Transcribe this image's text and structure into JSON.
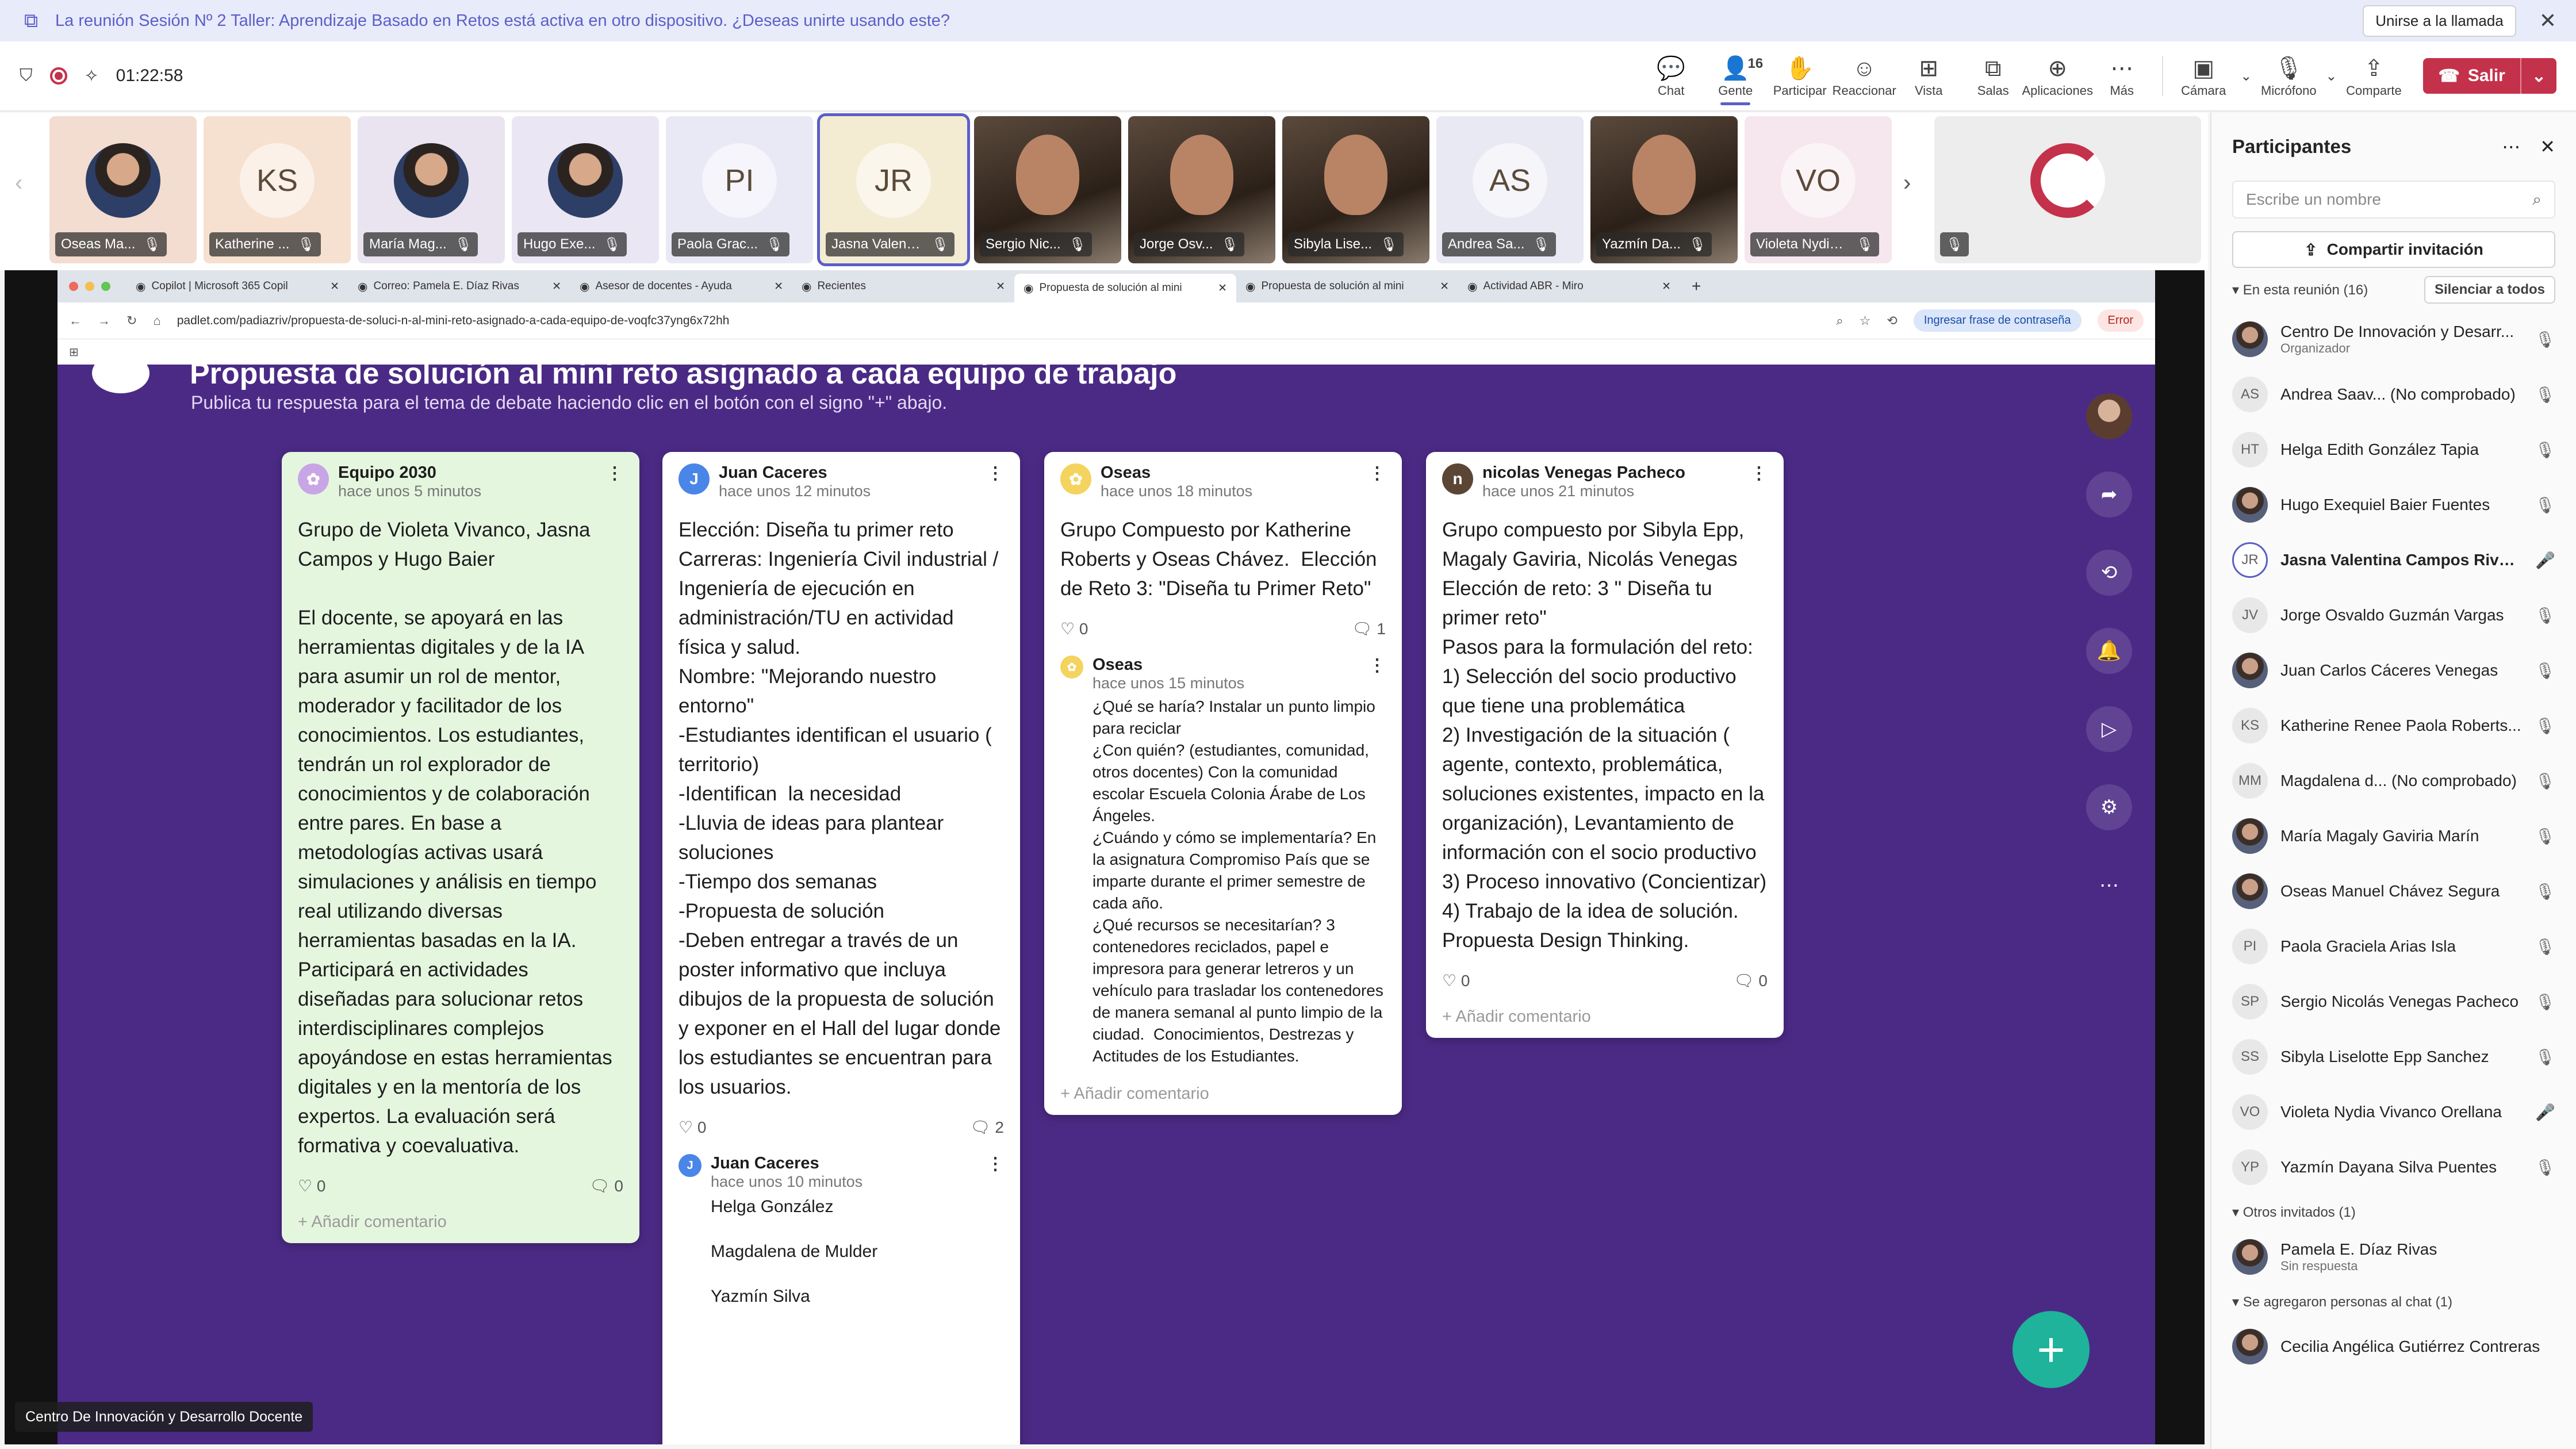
{
  "banner": {
    "text": "La reunión Sesión Nº 2 Taller: Aprendizaje Basado en Retos está activa en otro dispositivo. ¿Deseas unirte usando este?",
    "join_label": "Unirse a la llamada"
  },
  "toolbar": {
    "timer": "01:22:58",
    "people_count": "16",
    "buttons": {
      "chat": "Chat",
      "people": "Gente",
      "raise": "Participar",
      "react": "Reaccionar",
      "view": "Vista",
      "rooms": "Salas",
      "apps": "Aplicaciones",
      "more": "Más",
      "camera": "Cámara",
      "mic": "Micrófono",
      "share": "Comparte"
    },
    "leave_label": "Salir"
  },
  "strip": {
    "tiles": [
      {
        "name": "Oseas Ma...",
        "initials": ""
      },
      {
        "name": "Katherine ...",
        "initials": "KS"
      },
      {
        "name": "María Mag...",
        "initials": ""
      },
      {
        "name": "Hugo Exe...",
        "initials": ""
      },
      {
        "name": "Paola Grac...",
        "initials": "PI"
      },
      {
        "name": "Jasna Valentin...",
        "initials": "JR"
      },
      {
        "name": "Sergio Nic...",
        "initials": ""
      },
      {
        "name": "Jorge Osv...",
        "initials": ""
      },
      {
        "name": "Sibyla Lise...",
        "initials": ""
      },
      {
        "name": "Andrea Sa...",
        "initials": "AS"
      },
      {
        "name": "Yazmín Da...",
        "initials": ""
      },
      {
        "name": "Violeta Nydia ...",
        "initials": "VO"
      }
    ]
  },
  "browser": {
    "tabs": [
      "Copilot | Microsoft 365 Copil",
      "Correo: Pamela E. Díaz Rivas",
      "Asesor de docentes - Ayuda",
      "Recientes",
      "Propuesta de solución al mini",
      "Propuesta de solución al mini",
      "Actividad ABR - Miro"
    ],
    "url": "padlet.com/padiazriv/propuesta-de-soluci-n-al-mini-reto-asignado-a-cada-equipo-de-voqfc37yng6x72hh",
    "passphrase": "Ingresar frase de contraseña",
    "error": "Error"
  },
  "padlet": {
    "title": "Propuesta de solución al mini reto asignado a cada equipo de trabajo",
    "subtitle": "Publica tu respuesta para el tema de debate haciendo clic en el botón con el signo \"+\" abajo.",
    "add_comment": "Añadir comentario",
    "cards": [
      {
        "author": "Equipo 2030",
        "time": "hace unos 5 minutos",
        "body": "Grupo de Violeta Vivanco, Jasna Campos y Hugo Baier\n\nEl docente, se apoyará en las herramientas digitales y de la IA para asumir un rol de mentor, moderador y facilitador de los conocimientos. Los estudiantes, tendrán un rol explorador de conocimientos y de colaboración entre pares. En base a metodologías activas usará simulaciones y análisis en tiempo real utilizando diversas herramientas basadas en la IA. Participará en actividades diseñadas para solucionar retos interdisciplinares complejos apoyándose en estas herramientas digitales y en la mentoría de los expertos. La evaluación será formativa y coevaluativa.",
        "likes": "0",
        "comments": "0"
      },
      {
        "author": "Juan Caceres",
        "time": "hace unos 12 minutos",
        "body": "Elección: Diseña tu primer reto\nCarreras: Ingeniería Civil industrial / Ingeniería de ejecución en administración/TU en actividad física y salud.\nNombre: \"Mejorando nuestro entorno\"\n-Estudiantes identifican el usuario ( territorio)\n-Identifican  la necesidad\n-Lluvia de ideas para plantear soluciones\n-Tiempo dos semanas\n-Propuesta de solución\n-Deben entregar a través de un poster informativo que incluya dibujos de la propuesta de solución y exponer en el Hall del lugar donde los estudiantes se encuentran para  los usuarios.",
        "likes": "0",
        "comments": "2",
        "reply": {
          "author": "Juan Caceres",
          "time": "hace unos 10 minutos",
          "body": "Helga González\n\nMagdalena de Mulder\n\nYazmín Silva"
        }
      },
      {
        "author": "Oseas",
        "time": "hace unos 18 minutos",
        "body": "Grupo Compuesto por Katherine Roberts y Oseas Chávez.  Elección de Reto 3: \"Diseña tu Primer Reto\"",
        "likes": "0",
        "comments": "1",
        "reply": {
          "author": "Oseas",
          "time": "hace unos 15 minutos",
          "body": "¿Qué se haría? Instalar un punto limpio para reciclar\n¿Con quién? (estudiantes, comunidad, otros docentes) Con la comunidad escolar Escuela Colonia Árabe de Los Ángeles.\n¿Cuándo y cómo se implementaría? En la asignatura Compromiso País que se imparte durante el primer semestre de cada año.\n¿Qué recursos se necesitarían? 3 contenedores reciclados, papel e impresora para generar letreros y un vehículo para trasladar los contenedores de manera semanal al punto limpio de la ciudad.  Conocimientos, Destrezas y Actitudes de los Estudiantes."
        }
      },
      {
        "author": "nicolas Venegas Pacheco",
        "time": "hace unos 21 minutos",
        "body": "Grupo compuesto por Sibyla Epp, Magaly Gaviria, Nicolás Venegas Elección de reto: 3 \" Diseña tu primer reto\"\nPasos para la formulación del reto:\n1) Selección del socio productivo que tiene una problemática\n2) Investigación de la situación ( agente, contexto, problemática, soluciones existentes, impacto en la organización), Levantamiento de información con el socio productivo\n3) Proceso innovativo (Concientizar)\n4) Trabajo de la idea de solución. Propuesta Design Thinking.",
        "likes": "0",
        "comments": "0"
      }
    ]
  },
  "share_label": "Centro De Innovación y Desarrollo Docente",
  "panel": {
    "title": "Participantes",
    "search_placeholder": "Escribe un nombre",
    "invite_label": "Compartir invitación",
    "in_meeting": "En esta reunión (16)",
    "mute_all": "Silenciar a todos",
    "participants": [
      {
        "name": "Centro De Innovación y Desarr...",
        "sub": "Organizador",
        "initials": ""
      },
      {
        "name": "Andrea Saav... (No comprobado)",
        "sub": "",
        "initials": "AS"
      },
      {
        "name": "Helga Edith González Tapia",
        "sub": "",
        "initials": "HT"
      },
      {
        "name": "Hugo Exequiel Baier Fuentes",
        "sub": "",
        "initials": ""
      },
      {
        "name": "Jasna Valentina Campos Rivera",
        "sub": "",
        "initials": "JR"
      },
      {
        "name": "Jorge Osvaldo Guzmán Vargas",
        "sub": "",
        "initials": "JV"
      },
      {
        "name": "Juan Carlos Cáceres Venegas",
        "sub": "",
        "initials": ""
      },
      {
        "name": "Katherine Renee Paola Roberts...",
        "sub": "",
        "initials": "KS"
      },
      {
        "name": "Magdalena d... (No comprobado)",
        "sub": "",
        "initials": "MM"
      },
      {
        "name": "María Magaly Gaviria Marín",
        "sub": "",
        "initials": ""
      },
      {
        "name": "Oseas Manuel Chávez Segura",
        "sub": "",
        "initials": ""
      },
      {
        "name": "Paola Graciela Arias Isla",
        "sub": "",
        "initials": "PI"
      },
      {
        "name": "Sergio Nicolás Venegas Pacheco",
        "sub": "",
        "initials": "SP"
      },
      {
        "name": "Sibyla Liselotte Epp Sanchez",
        "sub": "",
        "initials": "SS"
      },
      {
        "name": "Violeta Nydia Vivanco Orellana",
        "sub": "",
        "initials": "VO"
      },
      {
        "name": "Yazmín Dayana Silva Puentes",
        "sub": "",
        "initials": "YP"
      }
    ],
    "others_invited": "Otros invitados (1)",
    "invited": [
      {
        "name": "Pamela E. Díaz Rivas",
        "sub": "Sin respuesta"
      }
    ],
    "added_chat": "Se agregaron personas al chat (1)",
    "added": [
      {
        "name": "Cecilia Angélica Gutiérrez Contreras"
      }
    ]
  }
}
